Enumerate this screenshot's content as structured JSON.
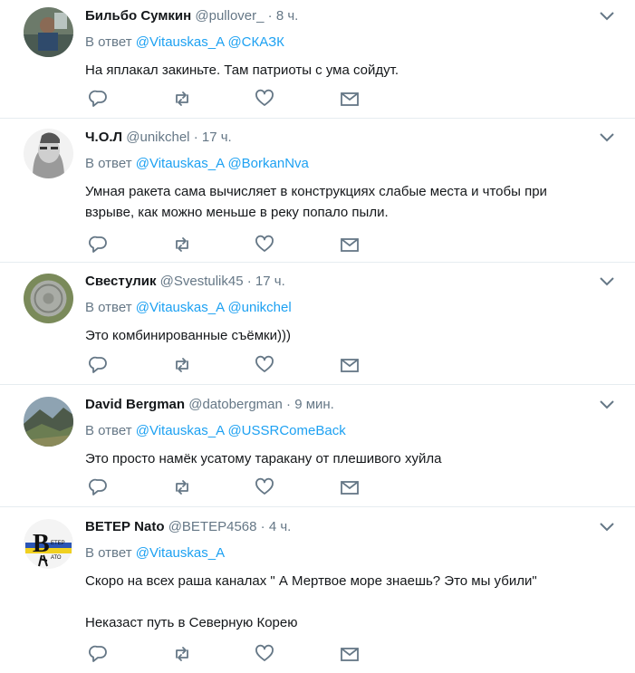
{
  "tweets": [
    {
      "name": "Бильбо Сумкин",
      "handle": "@pullover_",
      "dot": "·",
      "time": "8 ч.",
      "reply_prefix": "В ответ",
      "mentions": [
        "@Vitauskas_A",
        "@СКАЗК"
      ],
      "text": "На яплакал закиньте. Там патриоты с ума сойдут."
    },
    {
      "name": "Ч.О.Л",
      "handle": "@unikchel",
      "dot": "·",
      "time": "17 ч.",
      "reply_prefix": "В ответ",
      "mentions": [
        "@Vitauskas_A",
        "@BorkanNva"
      ],
      "text": "Умная ракета сама вычисляет в конструкциях слабые места и чтобы при\nвзрыве, как можно меньше в реку попало пыли."
    },
    {
      "name": "Свестулик",
      "handle": "@Svestulik45",
      "dot": "·",
      "time": "17 ч.",
      "reply_prefix": "В ответ",
      "mentions": [
        "@Vitauskas_A",
        "@unikchel"
      ],
      "text": "Это комбинированные съёмки)))"
    },
    {
      "name": "David Bergman",
      "handle": "@datobergman",
      "dot": "·",
      "time": "9 мин.",
      "reply_prefix": "В ответ",
      "mentions": [
        "@Vitauskas_A",
        "@USSRComeBack"
      ],
      "text": "Это просто намёк усатому таракану от плешивого хуйла"
    },
    {
      "name": "ВЕТЕР Nato",
      "handle": "@BETEP4568",
      "dot": "·",
      "time": "4 ч.",
      "reply_prefix": "В ответ",
      "mentions": [
        "@Vitauskas_A"
      ],
      "text": "Скоро на всех раша каналах \" А Мертвое море знаешь? Это мы убили\"\n\nНеказаст путь в Северную Корею",
      "avatar_letter": "В",
      "avatar_small_text": "ЕТЕР\nАТО"
    }
  ],
  "icons": {
    "reply": "reply-icon",
    "retweet": "retweet-icon",
    "like": "heart-icon",
    "dm": "envelope-icon",
    "caret": "chevron-down-icon"
  },
  "colors": {
    "text": "#14171a",
    "muted": "#657786",
    "link": "#1da1f2",
    "divider": "#e6ecf0",
    "icon": "#657786"
  }
}
